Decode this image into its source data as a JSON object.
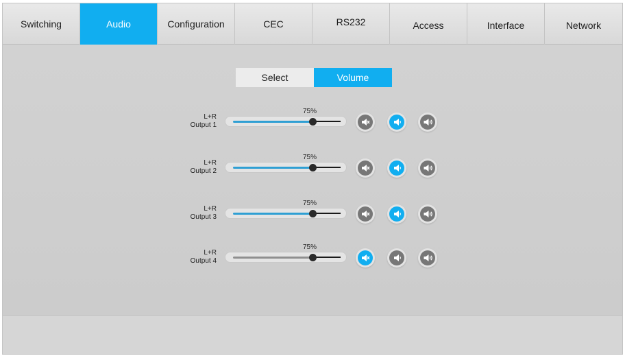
{
  "nav": {
    "tabs": [
      "Switching",
      "Audio",
      "Configuration",
      "CEC",
      "RS232",
      "Access",
      "Interface",
      "Network"
    ],
    "active": "Audio"
  },
  "subtabs": {
    "select": "Select",
    "volume": "Volume",
    "active": "Volume"
  },
  "colors": {
    "accent": "#11aef0",
    "track_fill": "#2f9fd3",
    "button_grey": "#777777"
  },
  "outputs": [
    {
      "channel": "L+R",
      "name": "Output 1",
      "volume_label": "75%",
      "volume": 75,
      "mute": false,
      "state": "volume"
    },
    {
      "channel": "L+R",
      "name": "Output 2",
      "volume_label": "75%",
      "volume": 75,
      "mute": false,
      "state": "volume"
    },
    {
      "channel": "L+R",
      "name": "Output 3",
      "volume_label": "75%",
      "volume": 75,
      "mute": false,
      "state": "volume"
    },
    {
      "channel": "L+R",
      "name": "Output 4",
      "volume_label": "75%",
      "volume": 75,
      "mute": true,
      "state": "mute"
    }
  ],
  "icons": {
    "mute": "speaker-mute-icon",
    "volume_down": "speaker-low-icon",
    "volume_up": "speaker-high-icon"
  }
}
